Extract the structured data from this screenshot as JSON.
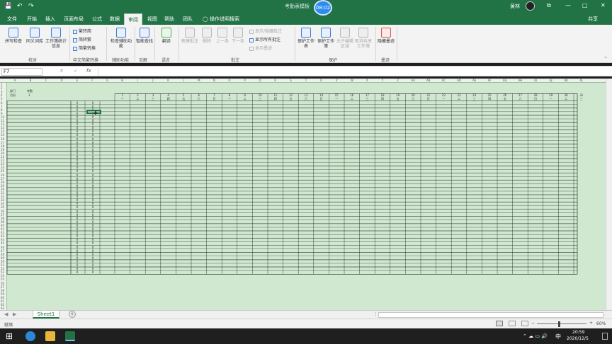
{
  "titlebar": {
    "doc_title": "考勤表模板",
    "timer": "08:02",
    "user": "黄林",
    "qa_save": "💾",
    "qa_undo": "↶",
    "qa_redo": "↷",
    "win_restore": "⧉",
    "win_min": "—",
    "win_max": "□",
    "win_close": "✕"
  },
  "tabs": [
    "文件",
    "开始",
    "插入",
    "页面布局",
    "公式",
    "数据",
    "审阅",
    "视图",
    "帮助",
    "团队"
  ],
  "active_tab": "审阅",
  "tellme": "操作说明搜索",
  "share": "共享",
  "ribbon": {
    "proofing": {
      "label": "校对",
      "spelling": "拼写检查",
      "thesaurus": "同义词库",
      "workbook_stats": "工作簿统计信息"
    },
    "chinese": {
      "label": "中文简繁转换",
      "to_trad": "繁转简",
      "to_simp": "简转繁",
      "convert": "简繁转换"
    },
    "accessibility": {
      "label": "辅助功能",
      "check": "检查辅助功能"
    },
    "insights": {
      "label": "见解",
      "smart_lookup": "智能查找"
    },
    "language": {
      "label": "语言",
      "translate": "翻译"
    },
    "comments": {
      "label": "批注",
      "new": "新建批注",
      "delete": "删除",
      "prev": "上一条",
      "next": "下一条",
      "show_hide": "显示/隐藏批注",
      "show_all": "显示所有批注",
      "show_ink": "显示墨迹"
    },
    "protect": {
      "label": "保护",
      "sheet": "保护工作表",
      "workbook": "保护工作簿",
      "allow_edit": "允许编辑区域",
      "unshare": "取消共享工作簿"
    },
    "ink": {
      "label": "墨迹",
      "hide_ink": "隐藏墨迹"
    }
  },
  "formula_bar": {
    "name_box": "F7",
    "cancel": "✕",
    "enter": "✓",
    "fx": "fx",
    "content": ""
  },
  "columns": [
    "A",
    "B",
    "C",
    "D",
    "E",
    "F",
    "G",
    "H",
    "I",
    "J",
    "K",
    "L",
    "M",
    "N",
    "O",
    "P",
    "Q",
    "R",
    "S",
    "T",
    "U",
    "V",
    "W",
    "X",
    "Y",
    "Z",
    "AA",
    "AB",
    "AC",
    "AD",
    "AE",
    "AF",
    "AG",
    "AH",
    "AI",
    "AJ",
    "AK",
    "AL"
  ],
  "sheet": {
    "labels": {
      "a2": "部门",
      "a3": "月份",
      "c2": "考勤",
      "c3": "1"
    },
    "day_numbers": [
      "1",
      "2",
      "3",
      "4",
      "5",
      "6",
      "7",
      "8",
      "9",
      "10",
      "11",
      "12",
      "13",
      "14",
      "15",
      "16",
      "17",
      "18",
      "19",
      "20",
      "21",
      "22",
      "23",
      "24",
      "25",
      "26",
      "27",
      "28",
      "29",
      "30",
      "31"
    ],
    "weekdays": [
      "一",
      "二",
      "三",
      "四",
      "五",
      "六",
      "日",
      "一",
      "二",
      "三",
      "四",
      "五",
      "六",
      "日",
      "一",
      "二",
      "三",
      "四",
      "五",
      "六",
      "日",
      "一",
      "二",
      "三",
      "四",
      "五",
      "六",
      "日",
      "一",
      "二",
      "三"
    ],
    "zero": "0"
  },
  "sheet_tab": "Sheet1",
  "add_sheet": "+",
  "status": {
    "ready": "就绪",
    "zoom": "60%",
    "zoom_minus": "−",
    "zoom_plus": "+"
  },
  "taskbar": {
    "time": "20:59",
    "date": "2020/12/5",
    "ime": "中",
    "systray": "⌃ ☁ ▭ 🔊"
  }
}
